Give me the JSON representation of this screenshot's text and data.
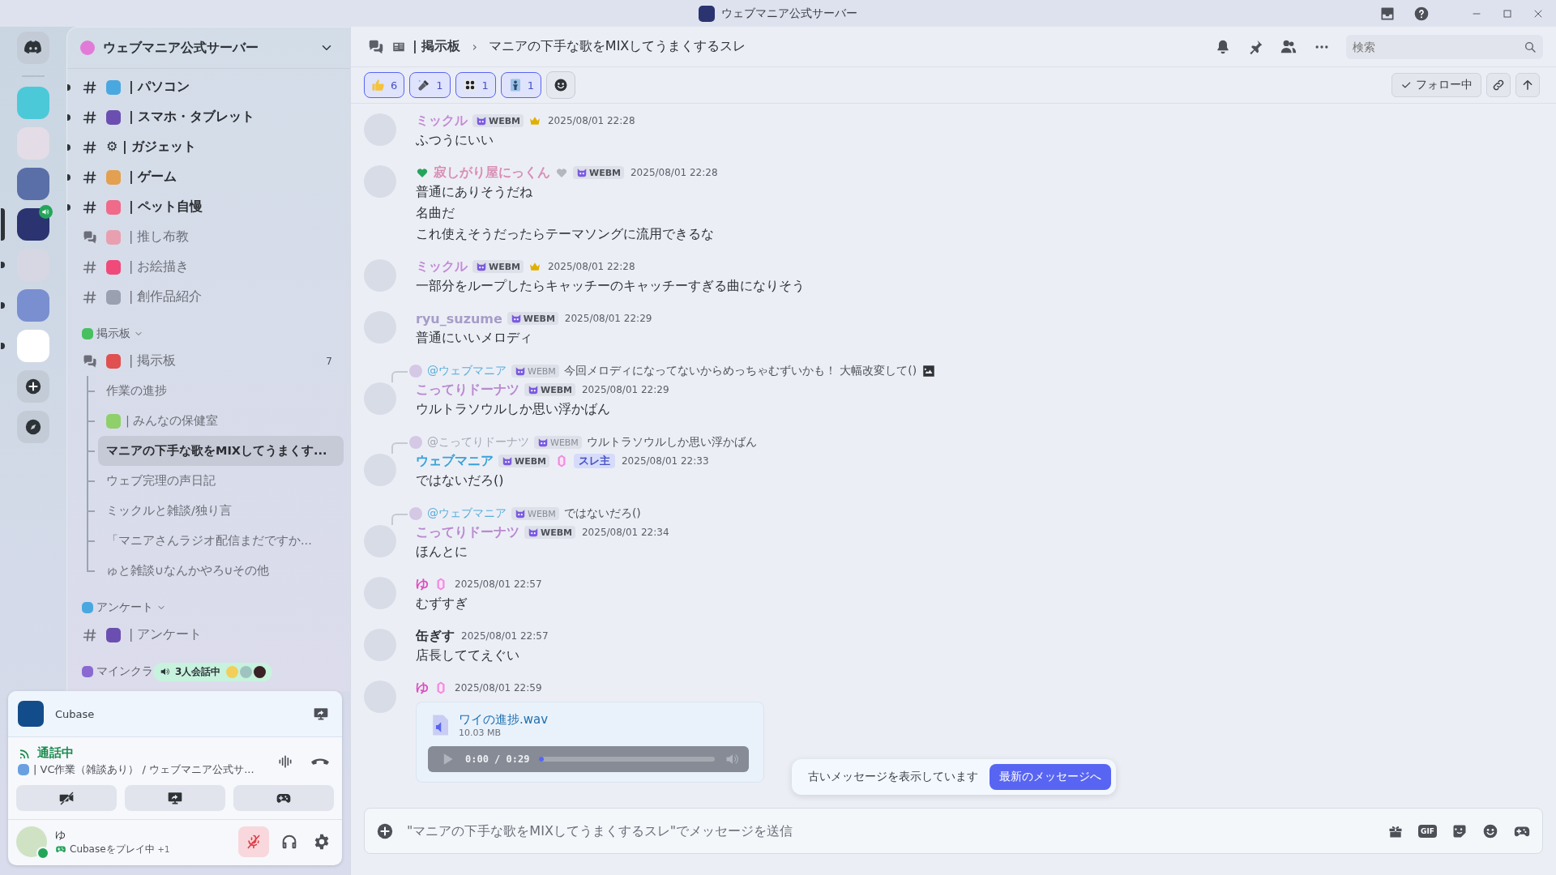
{
  "window": {
    "title": "ウェブマニア公式サーバー"
  },
  "servers": [
    {
      "color": "#4cc9d8",
      "selected": false,
      "unread": false,
      "voice": false
    },
    {
      "color": "#e4dce6",
      "selected": false,
      "unread": false,
      "voice": false
    },
    {
      "color": "#5a6fa8",
      "selected": false,
      "unread": false,
      "voice": false
    },
    {
      "color": "#2b3470",
      "selected": true,
      "unread": false,
      "voice": true
    },
    {
      "color": "#d6d7e2",
      "selected": false,
      "unread": true,
      "voice": false
    },
    {
      "color": "#7a8fd0",
      "selected": false,
      "unread": true,
      "voice": false
    },
    {
      "color": "#ffffff",
      "selected": false,
      "unread": true,
      "voice": false
    }
  ],
  "sidebar": {
    "server_name": "ウェブマニア公式サーバー",
    "channels": [
      {
        "kind": "text",
        "label": "| パソコン",
        "emoji": true,
        "unread": true,
        "selected": false
      },
      {
        "kind": "text",
        "label": "| スマホ・タブレット",
        "emoji": true,
        "unread": true,
        "selected": false
      },
      {
        "kind": "text",
        "label": "⚙ | ガジェット",
        "emoji": false,
        "unread": true,
        "selected": false
      },
      {
        "kind": "text",
        "label": "| ゲーム",
        "emoji": true,
        "unread": true,
        "selected": false
      },
      {
        "kind": "text",
        "label": "| ペット自慢",
        "emoji": true,
        "unread": true,
        "selected": false
      },
      {
        "kind": "forum",
        "label": "| 推し布教",
        "emoji": true,
        "unread": false,
        "selected": false
      },
      {
        "kind": "text",
        "label": "| お絵描き",
        "emoji": true,
        "unread": false,
        "selected": false
      },
      {
        "kind": "text",
        "label": "| 創作品紹介",
        "emoji": true,
        "unread": false,
        "selected": false
      },
      {
        "kind": "category",
        "label": "掲示板",
        "emoji": true,
        "expanded": true
      },
      {
        "kind": "forum",
        "label": "| 掲示板",
        "emoji": true,
        "unread": false,
        "selected": false,
        "count": "7",
        "children": [
          {
            "label": "作業の進捗",
            "emoji": false,
            "selected": false
          },
          {
            "label": "| みんなの保健室",
            "emoji": true,
            "selected": false
          },
          {
            "label": "マニアの下手な歌をMIXしてうまくす...",
            "emoji": false,
            "selected": true
          },
          {
            "label": "ウェブ完理の声日記",
            "emoji": false,
            "selected": false
          },
          {
            "label": "ミックルと雑談/独り言",
            "emoji": false,
            "selected": false
          },
          {
            "label": "「マニアさんラジオ配信まだですか...",
            "emoji": false,
            "selected": false
          },
          {
            "label": "ゅと雑談∪なんかやろ∪その他",
            "emoji": false,
            "selected": false
          }
        ]
      },
      {
        "kind": "category",
        "label": "アンケート",
        "emoji": true,
        "expanded": true
      },
      {
        "kind": "text",
        "label": "| アンケート",
        "emoji": true,
        "unread": false,
        "selected": false
      },
      {
        "kind": "category",
        "label": "マインクラ",
        "emoji": true
      }
    ],
    "voice_pill": {
      "label": "3人会話中"
    }
  },
  "activity_panel": {
    "app": "Cubase"
  },
  "voice": {
    "status": "通話中",
    "channel": "| VC作業（雑談あり） / ウェブマニア公式サ..."
  },
  "user": {
    "name": "ゆ",
    "activity": "Cubaseをプレイ中",
    "extra": "+1",
    "online": true,
    "muted": true
  },
  "header": {
    "channel": "| 掲示板",
    "separator": "›",
    "thread": "マニアの下手な歌をMIXしてうまくするスレ",
    "search": {
      "placeholder": "検索"
    }
  },
  "reactions": [
    {
      "count": "6",
      "selected": true
    },
    {
      "count": "1",
      "selected": true
    },
    {
      "count": "1",
      "selected": true
    },
    {
      "count": "1",
      "selected": true
    }
  ],
  "follow": {
    "label": "フォロー中",
    "following": true
  },
  "messages": [
    {
      "author": "ミックル",
      "color": "#c48bd6",
      "tag": "WEBM",
      "crown": true,
      "time": "2025/08/01 22:28",
      "lines": [
        "ふつうにいい"
      ]
    },
    {
      "author": "寂しがり屋にっくん",
      "color": "#d88fb4",
      "hearts": true,
      "tag": "WEBM",
      "time": "2025/08/01 22:28",
      "lines": [
        "普通にありそうだね",
        "名曲だ",
        "これ使えそうだったらテーマソングに流用できるな"
      ]
    },
    {
      "author": "ミックル",
      "color": "#c48bd6",
      "tag": "WEBM",
      "crown": true,
      "time": "2025/08/01 22:28",
      "lines": [
        "一部分をループしたらキャッチーのキャッチーすぎる曲になりそう"
      ]
    },
    {
      "author": "ryu_suzume",
      "color": "#a59dc8",
      "tag": "WEBM",
      "time": "2025/08/01 22:29",
      "lines": [
        "普通にいいメロディ"
      ]
    },
    {
      "reply": {
        "author": "@ウェブマニア",
        "color": "#5aaed8",
        "tag": "WEBM",
        "text": "今回メロディになってないからめっちゃむずいかも！ 大幅改変して()",
        "image": true
      },
      "author": "こってりドーナツ",
      "color": "#b98ad0",
      "tag": "WEBM",
      "time": "2025/08/01 22:29",
      "lines": [
        "ウルトラソウルしか思い浮かばん"
      ]
    },
    {
      "reply": {
        "author": "@こってりドーナツ",
        "color": "#a4a8b4",
        "tag": "WEBM",
        "text": "ウルトラソウルしか思い浮かばん"
      },
      "author": "ウェブマニア",
      "color": "#3aa2d8",
      "tag": "WEBM",
      "gem": true,
      "op_badge": "スレ主",
      "time": "2025/08/01 22:33",
      "lines": [
        "ではないだろ()"
      ]
    },
    {
      "reply": {
        "author": "@ウェブマニア",
        "color": "#5aaed8",
        "tag": "WEBM",
        "text": "ではないだろ()"
      },
      "author": "こってりドーナツ",
      "color": "#b98ad0",
      "tag": "WEBM",
      "time": "2025/08/01 22:34",
      "lines": [
        "ほんとに"
      ]
    },
    {
      "author": "ゆ",
      "color": "#dc4fbf",
      "gem": true,
      "time": "2025/08/01 22:57",
      "lines": [
        "むずすぎ"
      ]
    },
    {
      "author": "缶ぎす",
      "color": "#2e3338",
      "time": "2025/08/01 22:57",
      "lines": [
        "店長しててえぐい"
      ]
    },
    {
      "author": "ゆ",
      "color": "#dc4fbf",
      "gem": true,
      "time": "2025/08/01 22:59",
      "attachment": {
        "name": "ワイの進捗.wav",
        "size": "10.03 MB",
        "time": "0:00 / 0:29",
        "level": 0.01
      }
    }
  ],
  "jump_bar": {
    "text": "古いメッセージを表示しています",
    "button": "最新のメッセージへ"
  },
  "composer": {
    "placeholder": "\"マニアの下手な歌をMIXしてうまくするスレ\"でメッセージを送信",
    "gif_label": "GIF"
  }
}
